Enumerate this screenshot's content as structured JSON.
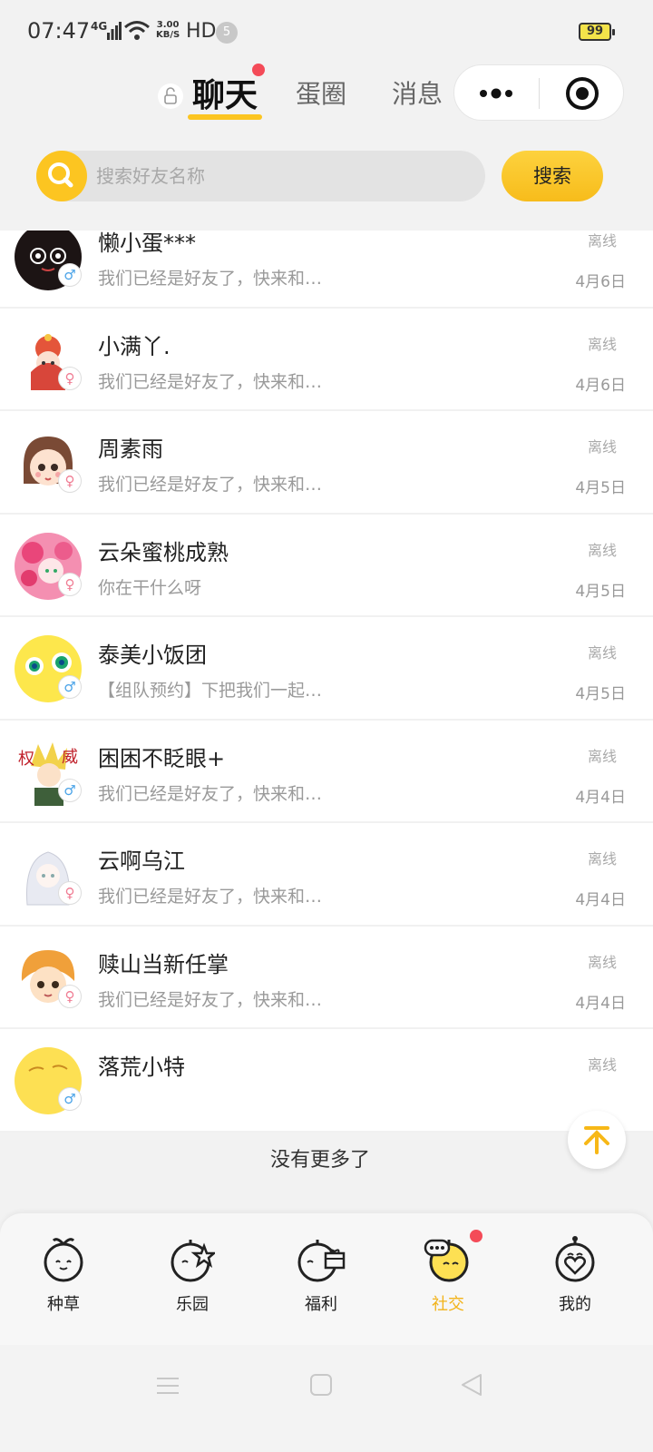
{
  "status_bar": {
    "time": "07:47",
    "network": "4G",
    "speed_value": "3.00",
    "speed_unit": "KB/S",
    "hd": "HD",
    "notification_count": "5",
    "battery": "99"
  },
  "tabs": [
    {
      "label": "聊天",
      "active": true
    },
    {
      "label": "蛋圈",
      "active": false
    },
    {
      "label": "消息",
      "active": false
    }
  ],
  "search": {
    "placeholder": "搜索好友名称",
    "button_label": "搜索"
  },
  "chats": [
    {
      "name": "懒小蛋***",
      "preview": "我们已经是好友了，快来和…",
      "status": "离线",
      "date": "4月6日",
      "gender": "♂",
      "avatar": "avatar-dark-cartoon"
    },
    {
      "name": "小满丫.",
      "preview": "我们已经是好友了，快来和…",
      "status": "离线",
      "date": "4月6日",
      "gender": "♀",
      "avatar": "avatar-anime-girl-red"
    },
    {
      "name": "周素雨",
      "preview": "我们已经是好友了，快来和…",
      "status": "离线",
      "date": "4月5日",
      "gender": "♀",
      "avatar": "avatar-cartoon-girl"
    },
    {
      "name": "云朵蜜桃成熟",
      "preview": "你在干什么呀",
      "status": "离线",
      "date": "4月5日",
      "gender": "♀",
      "avatar": "avatar-pink-anime"
    },
    {
      "name": "泰美小饭团",
      "preview": "【组队预约】下把我们一起…",
      "status": "离线",
      "date": "4月5日",
      "gender": "♂",
      "avatar": "avatar-yellow-egg"
    },
    {
      "name": "困困不眨眼+",
      "preview": "我们已经是好友了，快来和…",
      "status": "离线",
      "date": "4月4日",
      "gender": "♂",
      "avatar": "avatar-anime-blond"
    },
    {
      "name": "云啊乌江",
      "preview": "我们已经是好友了，快来和…",
      "status": "离线",
      "date": "4月4日",
      "gender": "♀",
      "avatar": "avatar-white-anime"
    },
    {
      "name": "赎山当新任掌",
      "preview": "我们已经是好友了，快来和…",
      "status": "离线",
      "date": "4月4日",
      "gender": "♀",
      "avatar": "avatar-orange-hair-boy"
    },
    {
      "name": "落荒小特",
      "preview": "",
      "status": "离线",
      "date": "",
      "gender": "♂",
      "avatar": "avatar-yellow-sleepy-egg"
    }
  ],
  "footer_text": "没有更多了",
  "bottom_nav": [
    {
      "label": "种草",
      "icon": "sprout-egg-icon",
      "active": false
    },
    {
      "label": "乐园",
      "icon": "star-egg-icon",
      "active": false
    },
    {
      "label": "福利",
      "icon": "gift-egg-icon",
      "active": false
    },
    {
      "label": "社交",
      "icon": "chat-egg-icon",
      "active": true
    },
    {
      "label": "我的",
      "icon": "heart-egg-icon",
      "active": false
    }
  ],
  "colors": {
    "accent": "#fcc521",
    "badge_red": "#f44b58",
    "active_nav": "#f2b319"
  }
}
